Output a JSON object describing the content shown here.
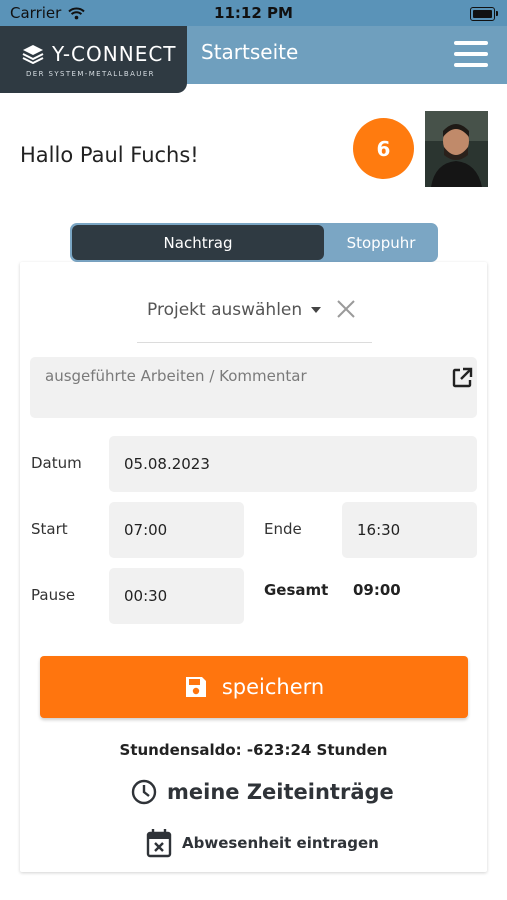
{
  "status_bar": {
    "carrier": "Carrier",
    "time": "11:12 PM"
  },
  "header": {
    "logo_text": "Y-CONNECT",
    "logo_subtitle": "DER SYSTEM-METALLBAUER",
    "title": "Startseite"
  },
  "greeting": "Hallo Paul Fuchs!",
  "notification_count": "6",
  "segments": {
    "active": "Nachtrag",
    "inactive": "Stoppuhr"
  },
  "form": {
    "project_placeholder": "Projekt auswählen",
    "comment_placeholder": "ausgeführte Arbeiten / Kommentar",
    "date_label": "Datum",
    "date_value": "05.08.2023",
    "start_label": "Start",
    "start_value": "07:00",
    "end_label": "Ende",
    "end_value": "16:30",
    "pause_label": "Pause",
    "pause_value": "00:30",
    "total_label": "Gesamt",
    "total_value": "09:00"
  },
  "save_label": "speichern",
  "balance": "Stundensaldo: -623:24 Stunden",
  "entries_link": "meine Zeiteinträge",
  "absence_link": "Abwesenheit eintragen",
  "colors": {
    "accent": "#ff750e",
    "header": "#6f9fbe",
    "dark": "#2f3a42"
  }
}
